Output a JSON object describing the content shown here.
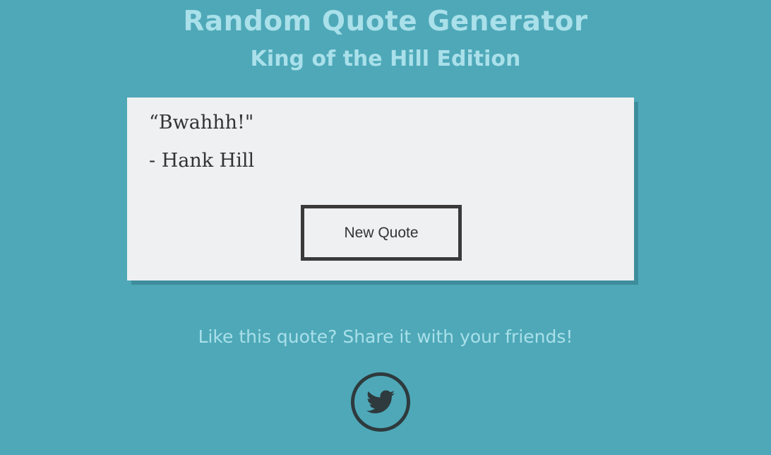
{
  "header": {
    "title": "Random Quote Generator",
    "subtitle": "King of the Hill Edition"
  },
  "quote": {
    "text": "“Bwahhh!\"",
    "author": "- Hank Hill"
  },
  "actions": {
    "new_quote_label": "New Quote"
  },
  "share": {
    "prompt": "Like this quote? Share it with your friends!",
    "icon": "twitter-icon"
  },
  "colors": {
    "background": "#4ea8b8",
    "heading_text": "#a9e0ea",
    "card_background": "#eef0f1",
    "card_shadow": "#3e8d9c",
    "dark": "#2e3a3d"
  }
}
